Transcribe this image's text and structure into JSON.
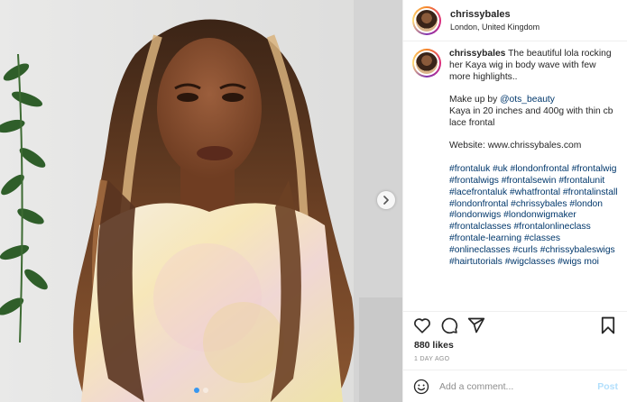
{
  "post": {
    "username": "chrissybales",
    "location": "London, United Kingdom"
  },
  "caption": {
    "username": "chrissybales",
    "intro": "The beautiful lola rocking her Kaya wig in body wave with few more highlights..",
    "makeup_prefix": "Make up by ",
    "makeup_handle": "@ots_beauty",
    "details": "Kaya in 20 inches and 400g with thin cb lace frontal",
    "website": "Website: www.chrissybales.com",
    "hashtags": "#frontaluk #uk #londonfrontal #frontalwig #frontalwigs #frontalsewin #frontalunit #lacefrontaluk #whatfrontal #frontalinstall #londonfrontal #chrissybales #london #londonwigs #londonwigmaker #frontalclasses #frontalonlineclass #frontale-learning #classes #onlineclasses #curls #chrissybaleswigs #hairtutorials #wigclasses #wigs moi"
  },
  "stats": {
    "likes": "880 likes",
    "time_ago": "1 DAY AGO"
  },
  "comment_box": {
    "placeholder": "Add a comment...",
    "post_label": "Post"
  },
  "carousel": {
    "dots": 2,
    "active_index": 0
  },
  "icons": {
    "like": "heart-icon",
    "comment": "comment-icon",
    "share": "share-icon",
    "save": "bookmark-icon",
    "next": "chevron-right-icon",
    "emoji": "emoji-icon"
  },
  "colors": {
    "link": "#00376b",
    "post_button": "#b2dffc",
    "muted": "#8e8e8e",
    "carousel_active": "#3897f0"
  }
}
